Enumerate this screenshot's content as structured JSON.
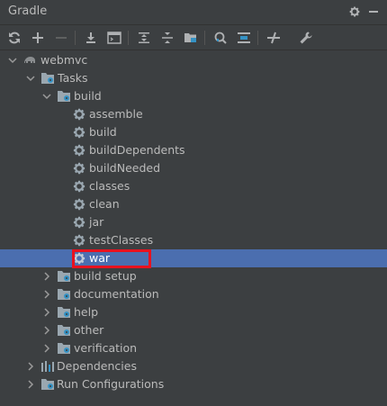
{
  "header": {
    "title": "Gradle"
  },
  "tree": {
    "project": "webmvc",
    "tasks": "Tasks",
    "build_group": "build",
    "build_tasks": [
      "assemble",
      "build",
      "buildDependents",
      "buildNeeded",
      "classes",
      "clean",
      "jar",
      "testClasses",
      "war"
    ],
    "other_groups": [
      "build setup",
      "documentation",
      "help",
      "other",
      "verification"
    ],
    "dependencies": "Dependencies",
    "run_configurations": "Run Configurations"
  },
  "selection": {
    "selected_task": "war",
    "highlight_color": "#e8121f",
    "selection_bg": "#4b6eaf"
  }
}
